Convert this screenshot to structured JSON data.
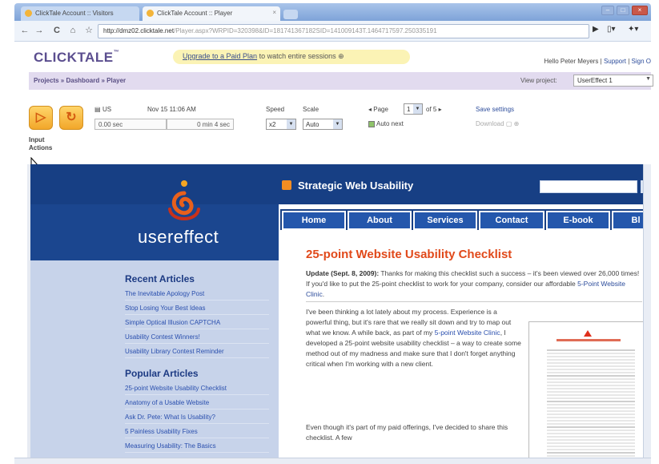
{
  "browser": {
    "tabs": [
      {
        "label": "ClickTale Account :: Visitors"
      },
      {
        "label": "ClickTale Account :: Player"
      }
    ],
    "url_host": "http://dmz02.clicktale.net",
    "url_path": "/Player.aspx?WRPID=320398&ID=181741367182SID=141009143T.1464717597.250335191"
  },
  "app": {
    "logo": "CLICKTALE",
    "logo_tm": "™",
    "upgrade_link": "Upgrade to a Paid Plan",
    "upgrade_rest": " to watch entire sessions",
    "user_greeting": "Hello Peter Meyers",
    "support_link": "Support",
    "signout_link": "Sign O",
    "breadcrumb": "Projects » Dashboard » Player",
    "view_project_label": "View project:",
    "project_selected": "UserEffect 1"
  },
  "player": {
    "input_label": "Input",
    "actions_label": "Actions",
    "country": "US",
    "date": "Nov 15 11:06 AM",
    "time_current": "0.00 sec",
    "time_total": "0 min 4 sec",
    "speed_label": "Speed",
    "speed_value": "x2",
    "scale_label": "Scale",
    "scale_value": "Auto",
    "page_label": "◂ Page",
    "page_value": "1",
    "page_of": "of 5 ▸",
    "auto_next": "Auto next",
    "save_settings": "Save settings",
    "download": "Download"
  },
  "site": {
    "blog_name": "Strategic Web Usability",
    "brand": "usereffect",
    "nav": [
      "Home",
      "About",
      "Services",
      "Contact",
      "E-book",
      "Bl"
    ],
    "recent_heading": "Recent Articles",
    "recent": [
      "The Inevitable Apology Post",
      "Stop Losing Your Best Ideas",
      "Simple Optical Illusion CAPTCHA",
      "Usability Contest Winners!",
      "Usability Library Contest Reminder"
    ],
    "popular_heading": "Popular Articles",
    "popular": [
      "25-point Website Usability Checklist",
      "Anatomy of a Usable Website",
      "Ask Dr. Pete: What Is Usability?",
      "5 Painless Usability Fixes",
      "Measuring Usability: The Basics"
    ],
    "post_title": "25-point Website Usability Checklist",
    "update_bold": "Update (Sept. 8, 2009):",
    "update_text": " Thanks for making this checklist such a success – it's been viewed over 26,000 times! If you'd like to put the 25-point checklist to work for your company, consider our affordable ",
    "update_link": "5-Point Website Clinic",
    "para1_a": "I've been thinking a lot lately about my process. Experience is a powerful thing, but it's rare that we really sit down and try to map out what we know. A while back, as part of my ",
    "para1_link": "5-point Website Clinic",
    "para1_b": ", I developed a 25-point website usability checklist – a way to create some method out of my madness and make sure that I don't forget anything critical when I'm working with a new client.",
    "para2": "Even though it's part of my paid offerings, I've decided to share this checklist. A few"
  }
}
